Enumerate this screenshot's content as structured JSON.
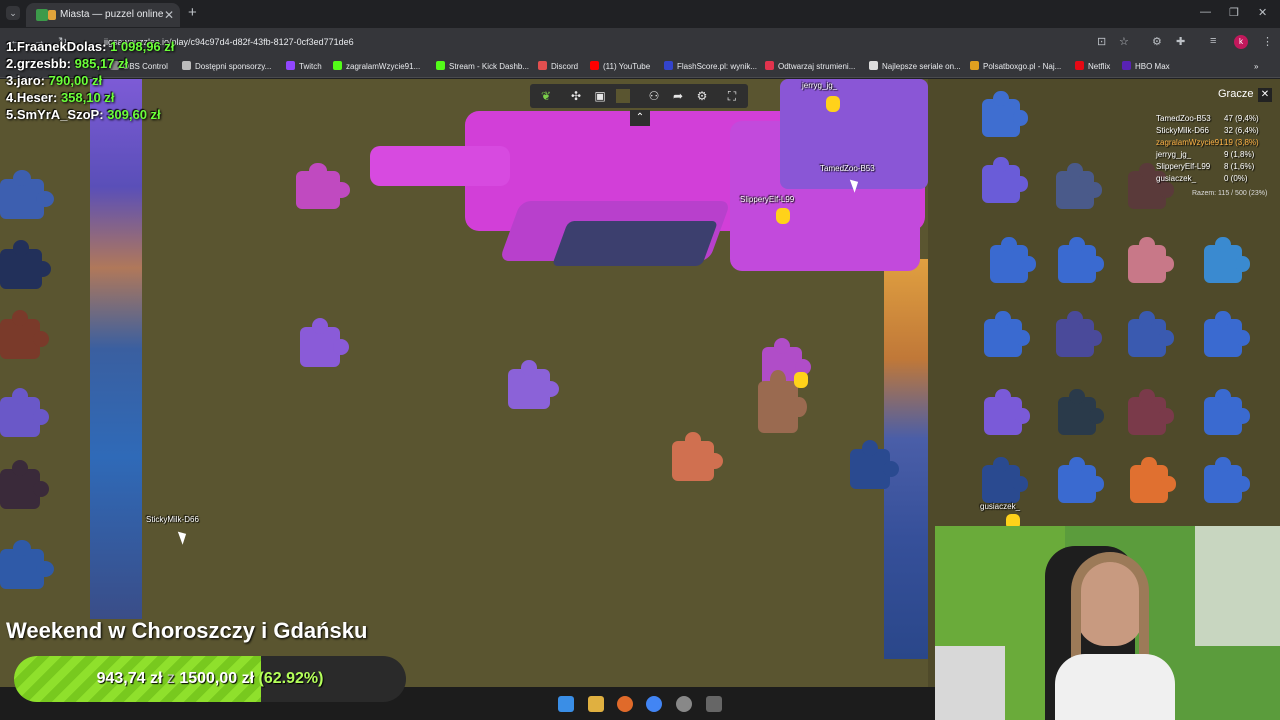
{
  "browser": {
    "tab_title": "Miasta — puzzel online",
    "address": "jigsawpuzzles.io/play/c94c97d4-d82f-43fb-8127-0cf3ed771de6",
    "bookmarks": [
      {
        "label": "OBS Control",
        "color": "#888888"
      },
      {
        "label": "Dostępni sponsorzy...",
        "color": "#bbbbbb"
      },
      {
        "label": "Twitch",
        "color": "#9146ff"
      },
      {
        "label": "zagralamWzycie91...",
        "color": "#53fc18"
      },
      {
        "label": "Stream - Kick Dashb...",
        "color": "#53fc18"
      },
      {
        "label": "Discord",
        "color": "#e24f4f"
      },
      {
        "label": "(11) YouTube",
        "color": "#ff0000"
      },
      {
        "label": "FlashScore.pl: wynik...",
        "color": "#3344cc"
      },
      {
        "label": "Odtwarzaj strumieni...",
        "color": "#e0334d"
      },
      {
        "label": "Najlepsze seriale on...",
        "color": "#dddddd"
      },
      {
        "label": "Polsatboxgo.pl - Naj...",
        "color": "#e0a020"
      },
      {
        "label": "Netflix",
        "color": "#e50914"
      },
      {
        "label": "HBO Max",
        "color": "#5822b4"
      }
    ]
  },
  "leaderboard": [
    {
      "name": "1.FraanekDolas:",
      "amount": "1 098,96 zł"
    },
    {
      "name": "2.grzesbb:",
      "amount": "985,17 zł"
    },
    {
      "name": "3.jaro:",
      "amount": "790,00 zł"
    },
    {
      "name": "4.Heser:",
      "amount": "358,10 zł"
    },
    {
      "name": "5.SmYrA_SzoP:",
      "amount": "309,60 zł"
    }
  ],
  "players_panel": {
    "title": "Gracze",
    "players": [
      {
        "name": "TamedZoo-B53",
        "value": "47 (9,4%)",
        "color": "#ffffff"
      },
      {
        "name": "StickyMilk-D66",
        "value": "32 (6,4%)",
        "color": "#ffffff"
      },
      {
        "name": "zagralamWzycie91",
        "value": "19 (3,8%)",
        "color": "#ffb347"
      },
      {
        "name": "jerryg_jg_",
        "value": "9 (1,8%)",
        "color": "#ffffff"
      },
      {
        "name": "SlipperyElf-L99",
        "value": "8 (1,6%)",
        "color": "#ffffff"
      },
      {
        "name": "gusiaczek_",
        "value": "0 (0%)",
        "color": "#ffffff"
      }
    ],
    "totals": "Razem: 115 / 500 (23%)"
  },
  "cursors": [
    {
      "label": "jerryg_jg_"
    },
    {
      "label": "TamedZoo-B53"
    },
    {
      "label": "SlipperyElf-L99"
    },
    {
      "label": "StickyMilk-D66"
    },
    {
      "label": "gusiaczek_"
    }
  ],
  "goal": {
    "title": "Weekend w Choroszczy i Gdańsku",
    "current": "943,74 zł",
    "sep": "z",
    "target": "1500,00 zł",
    "percent_text": "(62.92%)",
    "fraction": 0.6292
  },
  "icons": {
    "game_tools": [
      "logo-icon",
      "puzzle-icon",
      "preview-icon",
      "background-icon",
      "players-icon",
      "share-icon",
      "settings-icon",
      "fullscreen-icon"
    ]
  }
}
